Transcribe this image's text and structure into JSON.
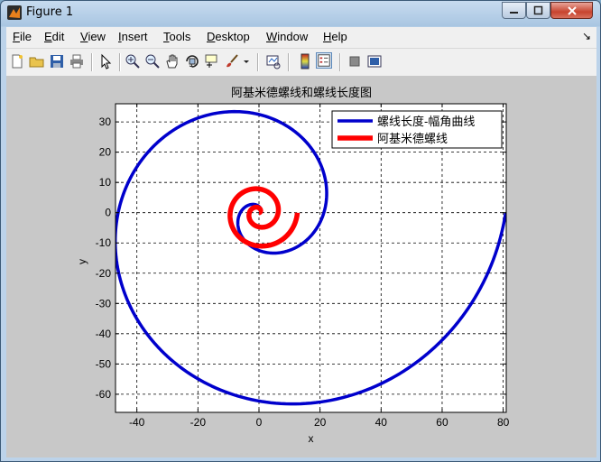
{
  "window": {
    "title": "Figure 1"
  },
  "menu": [
    {
      "label": "File",
      "u": "F",
      "rest": "ile"
    },
    {
      "label": "Edit",
      "u": "E",
      "rest": "dit"
    },
    {
      "label": "View",
      "u": "V",
      "rest": "iew"
    },
    {
      "label": "Insert",
      "u": "I",
      "rest": "nsert"
    },
    {
      "label": "Tools",
      "u": "T",
      "rest": "ools"
    },
    {
      "label": "Desktop",
      "u": "D",
      "rest": "esktop"
    },
    {
      "label": "Window",
      "u": "W",
      "rest": "indow"
    },
    {
      "label": "Help",
      "u": "H",
      "rest": "elp"
    }
  ],
  "toolbar_icons": [
    "new-figure-icon",
    "open-icon",
    "save-icon",
    "print-icon",
    "edit-plot-icon",
    "zoom-in-icon",
    "zoom-out-icon",
    "pan-icon",
    "rotate-3d-icon",
    "data-cursor-icon",
    "brush-icon",
    "link-plot-icon",
    "colorbar-icon",
    "legend-icon",
    "hide-plot-tools-icon",
    "show-plot-tools-icon"
  ],
  "chart_data": {
    "type": "line",
    "title": "阿基米德螺线和螺线长度图",
    "xlabel": "x",
    "ylabel": "y",
    "xlim": [
      -47,
      81
    ],
    "ylim": [
      -66,
      36
    ],
    "xticks": [
      -40,
      -20,
      0,
      20,
      40,
      60,
      80
    ],
    "yticks": [
      30,
      20,
      10,
      0,
      -10,
      -20,
      -30,
      -40,
      -50,
      -60
    ],
    "grid": true,
    "grid_style": "dashed",
    "legend_position": "top-right",
    "series": [
      {
        "name": "螺线长度-幅角曲线",
        "color": "#0000cc",
        "kind": "spiral_length",
        "a": 1,
        "theta_range": [
          0,
          12.566
        ]
      },
      {
        "name": "阿基米德螺线",
        "color": "#ff0000",
        "kind": "archimedes",
        "a": 1,
        "theta_range": [
          0,
          12.566
        ]
      }
    ]
  }
}
